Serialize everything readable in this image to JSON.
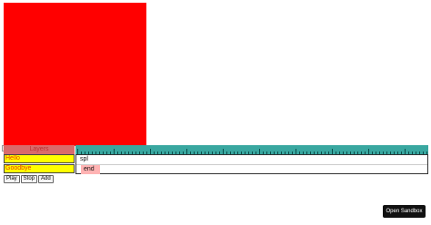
{
  "canvas": {
    "color": "#ff0000"
  },
  "timeline": {
    "layers_label": "Layers",
    "layers": [
      {
        "name": "Hello"
      },
      {
        "name": "Goodbye"
      }
    ],
    "clips": [
      {
        "label": "spl"
      },
      {
        "label": "end"
      }
    ]
  },
  "controls": {
    "play_label": "Play",
    "stop_label": "Stop",
    "add_label": "Add"
  },
  "sandbox_button": {
    "label": "Open Sandbox"
  },
  "colors": {
    "canvas": "#ff0000",
    "layer_bg": "#ffff00",
    "ruler": "#39a7a0",
    "clip_end": "#ffb3b3",
    "sandbox_bg": "#111111"
  }
}
